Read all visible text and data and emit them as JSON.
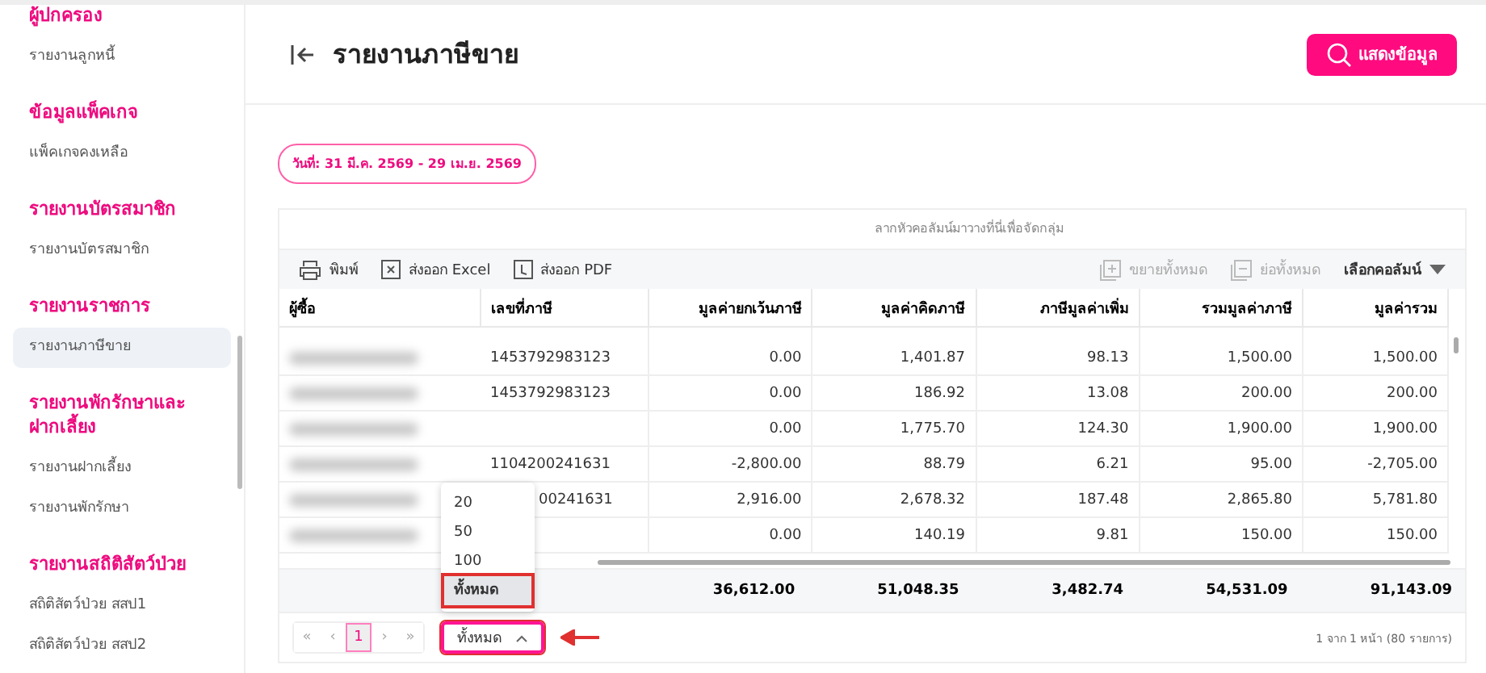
{
  "sidebar": {
    "sections": [
      {
        "heading": "ผู้ปกครอง",
        "items": [
          {
            "label": "รายงานลูกหนี้",
            "selected": false
          }
        ]
      },
      {
        "heading": "ข้อมูลแพ็คเกจ",
        "items": [
          {
            "label": "แพ็คเกจคงเหลือ",
            "selected": false
          }
        ]
      },
      {
        "heading": "รายงานบัตรสมาชิก",
        "items": [
          {
            "label": "รายงานบัตรสมาชิก",
            "selected": false
          }
        ]
      },
      {
        "heading": "รายงานราชการ",
        "items": [
          {
            "label": "รายงานภาษีขาย",
            "selected": true
          }
        ]
      },
      {
        "heading": "รายงานพักรักษาและฝากเลี้ยง",
        "items": [
          {
            "label": "รายงานฝากเลี้ยง",
            "selected": false
          },
          {
            "label": "รายงานพักรักษา",
            "selected": false
          }
        ]
      },
      {
        "heading": "รายงานสถิติสัตว์ป่วย",
        "items": [
          {
            "label": "สถิติสัตว์ป่วย สสป1",
            "selected": false
          },
          {
            "label": "สถิติสัตว์ป่วย สสป2",
            "selected": false
          }
        ]
      }
    ]
  },
  "header": {
    "title": "รายงานภาษีขาย",
    "show_button": "แสดงข้อมูล"
  },
  "date_range": "วันที่: 31 มี.ค. 2569 - 29 เม.ย. 2569",
  "grid": {
    "group_hint": "ลากหัวคอลัมน์มาวางที่นี่เพื่อจัดกลุ่ม",
    "toolbar": [
      {
        "kind": "print",
        "label": "พิมพ์",
        "disabled": false
      },
      {
        "kind": "excel",
        "label": "ส่งออก Excel",
        "disabled": false
      },
      {
        "kind": "pdf",
        "label": "ส่งออก PDF",
        "disabled": false
      }
    ],
    "toolbar_right": [
      {
        "kind": "expand",
        "label": "ขยายทั้งหมด",
        "disabled": true
      },
      {
        "kind": "collapse",
        "label": "ย่อทั้งหมด",
        "disabled": true
      },
      {
        "kind": "columns",
        "label": "เลือกคอลัมน์",
        "disabled": false
      }
    ],
    "columns": [
      "ผู้ซื้อ",
      "เลขที่ภาษี",
      "มูลค่ายกเว้นภาษี",
      "มูลค่าคิดภาษี",
      "ภาษีมูลค่าเพิ่ม",
      "รวมมูลค่าภาษี",
      "มูลค่ารวม"
    ],
    "rows": [
      [
        "",
        "1453792983123",
        "0.00",
        "1,401.87",
        "98.13",
        "1,500.00",
        "1,500.00"
      ],
      [
        "",
        "1453792983123",
        "0.00",
        "186.92",
        "13.08",
        "200.00",
        "200.00"
      ],
      [
        "",
        "",
        "0.00",
        "1,775.70",
        "124.30",
        "1,900.00",
        "1,900.00"
      ],
      [
        "",
        "1104200241631",
        "-2,800.00",
        "88.79",
        "6.21",
        "95.00",
        "-2,705.00"
      ],
      [
        "",
        "00241631",
        "2,916.00",
        "2,678.32",
        "187.48",
        "2,865.80",
        "5,781.80"
      ],
      [
        "",
        "",
        "0.00",
        "140.19",
        "9.81",
        "150.00",
        "150.00"
      ]
    ],
    "totals": [
      "36,612.00",
      "51,048.35",
      "3,482.74",
      "54,531.09",
      "91,143.09"
    ],
    "pager": {
      "first": "«",
      "prev": "‹",
      "next": "›",
      "last": "»",
      "pages": [
        {
          "label": "1",
          "selected": true
        }
      ],
      "page_size": "ทั้งหมด",
      "expanded": true,
      "options": [
        {
          "label": "20",
          "selected": false
        },
        {
          "label": "50",
          "selected": false
        },
        {
          "label": "100",
          "selected": false
        },
        {
          "label": "ทั้งหมด",
          "selected": true
        }
      ],
      "info": "1 จาก 1 หน้า (80 รายการ)"
    }
  }
}
